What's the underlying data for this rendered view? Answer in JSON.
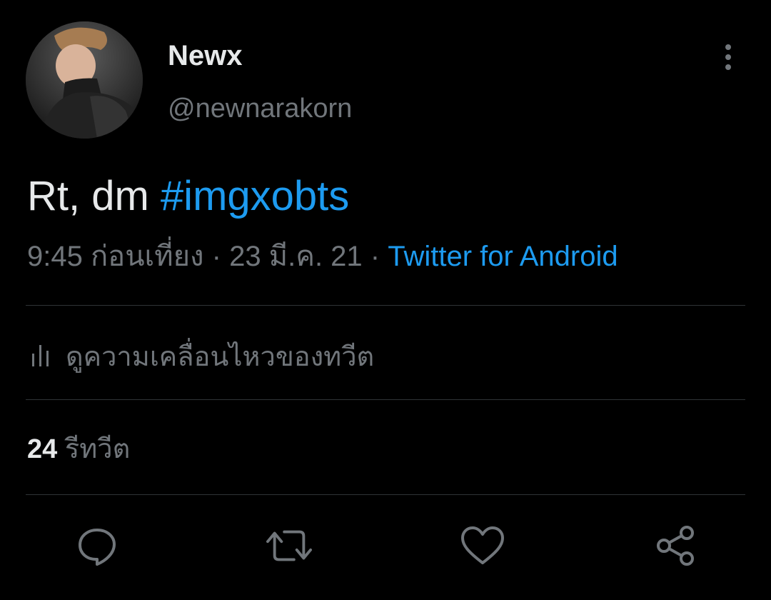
{
  "author": {
    "display_name": "Newx",
    "handle": "@newnarakorn",
    "avatar_icon": "profile-photo"
  },
  "tweet": {
    "text": "Rt, dm ",
    "hashtag": "#imgxobts",
    "time": "9:45 ก่อนเที่ยง",
    "separator": " · ",
    "date": "23 มี.ค. 21",
    "source": "Twitter for Android"
  },
  "activity": {
    "label": "ดูความเคลื่อนไหวของทวีต",
    "icon": "bar-chart-icon"
  },
  "stats": {
    "retweet_count": "24",
    "retweet_label": "รีทวีต"
  },
  "actions": {
    "reply_icon": "reply-icon",
    "retweet_icon": "retweet-icon",
    "like_icon": "heart-icon",
    "share_icon": "share-icon"
  },
  "colors": {
    "background": "#000000",
    "text": "#e7e9ea",
    "secondary": "#71767b",
    "accent": "#1d9bf0",
    "divider": "#2f3336"
  }
}
